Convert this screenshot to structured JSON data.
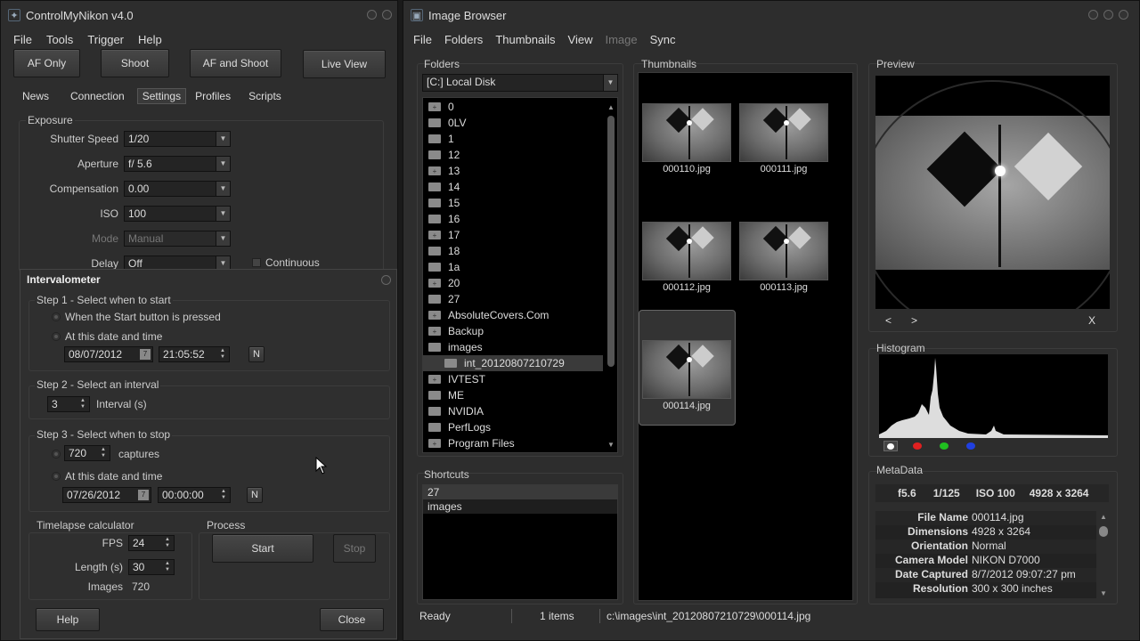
{
  "left": {
    "title": "ControlMyNikon v4.0",
    "menu": [
      "File",
      "Tools",
      "Trigger",
      "Help"
    ],
    "buttons": {
      "af_only": "AF Only",
      "shoot": "Shoot",
      "af_shoot": "AF and Shoot",
      "live_view": "Live View"
    },
    "tabs": [
      "News",
      "Connection",
      "Settings",
      "Profiles",
      "Scripts"
    ],
    "exposure": {
      "title": "Exposure",
      "shutter_label": "Shutter Speed",
      "shutter_value": "1/20",
      "aperture_label": "Aperture",
      "aperture_value": "f/ 5.6",
      "comp_label": "Compensation",
      "comp_value": "0.00",
      "iso_label": "ISO",
      "iso_value": "100",
      "mode_label": "Mode",
      "mode_value": "Manual",
      "delay_label": "Delay",
      "delay_value": "Off",
      "continuous_label": "Continuous"
    }
  },
  "interval": {
    "title": "Intervalometer",
    "step1": {
      "title": "Step 1 - Select when to start",
      "opt1": "When the Start button is pressed",
      "opt2": "At this date and time",
      "date": "08/07/2012",
      "time": "21:05:52",
      "n": "N"
    },
    "step2": {
      "title": "Step 2 - Select an interval",
      "value": "3",
      "label": "Interval (s)"
    },
    "step3": {
      "title": "Step 3 - Select when to stop",
      "captures_value": "720",
      "captures_label": "captures",
      "opt2": "At this date and time",
      "date": "07/26/2012",
      "time": "00:00:00",
      "n": "N"
    },
    "calc": {
      "title": "Timelapse calculator",
      "fps_label": "FPS",
      "fps_value": "24",
      "length_label": "Length (s)",
      "length_value": "30",
      "images_label": "Images",
      "images_value": "720"
    },
    "process": {
      "title": "Process",
      "start": "Start",
      "stop": "Stop"
    },
    "help": "Help",
    "close": "Close"
  },
  "browser": {
    "title": "Image Browser",
    "menu": [
      "File",
      "Folders",
      "Thumbnails",
      "View",
      "Image",
      "Sync"
    ],
    "folders_title": "Folders",
    "drive": "[C:] Local Disk",
    "folders": [
      "0",
      "0LV",
      "1",
      "12",
      "13",
      "14",
      "15",
      "16",
      "17",
      "18",
      "1a",
      "20",
      "27",
      "AbsoluteCovers.Com",
      "Backup",
      "images",
      "int_20120807210729",
      "IVTEST",
      "ME",
      "NVIDIA",
      "PerfLogs",
      "Program Files"
    ],
    "shortcuts_title": "Shortcuts",
    "shortcuts": [
      "27",
      "images"
    ],
    "thumbs_title": "Thumbnails",
    "thumbs": [
      "000110.jpg",
      "000111.jpg",
      "000112.jpg",
      "000113.jpg",
      "000114.jpg"
    ],
    "preview_title": "Preview",
    "prev": "<",
    "next": ">",
    "x": "X",
    "histogram_title": "Histogram",
    "metadata_title": "MetaData",
    "summary": {
      "aperture": "f5.6",
      "shutter": "1/125",
      "iso": "ISO 100",
      "size": "4928 x 3264"
    },
    "meta": [
      {
        "k": "File Name",
        "v": "000114.jpg"
      },
      {
        "k": "Dimensions",
        "v": "4928 x 3264"
      },
      {
        "k": "Orientation",
        "v": "Normal"
      },
      {
        "k": "Camera Model",
        "v": "NIKON D7000"
      },
      {
        "k": "Date Captured",
        "v": "8/7/2012 09:07:27 pm"
      },
      {
        "k": "Resolution",
        "v": "300 x 300 inches"
      }
    ],
    "status": {
      "ready": "Ready",
      "items": "1 items",
      "path": "c:\\images\\int_20120807210729\\000114.jpg"
    }
  }
}
